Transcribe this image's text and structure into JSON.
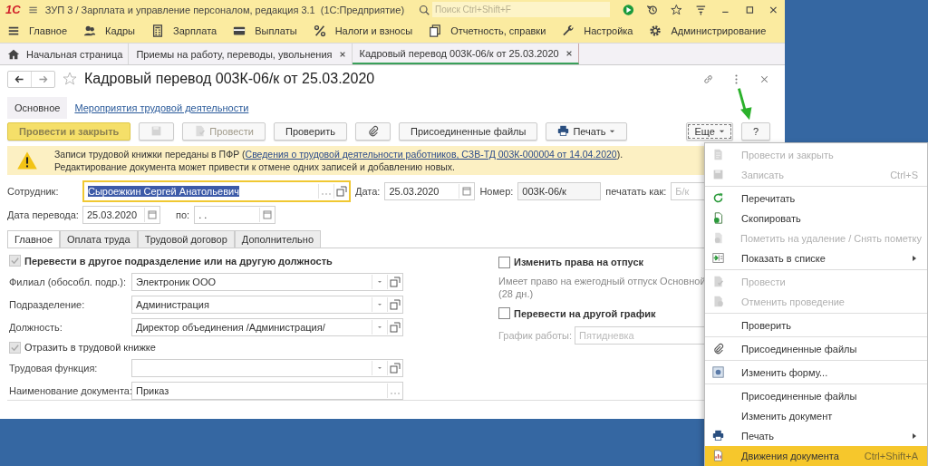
{
  "window": {
    "logo": "1С",
    "title": "ЗУП 3 / Зарплата и управление персоналом, редакция 3.1  (1С:Предприятие)",
    "search": {
      "placeholder": "Поиск Ctrl+Shift+F"
    }
  },
  "sections": [
    {
      "kind": "menu",
      "label": "Главное"
    },
    {
      "kind": "people",
      "label": "Кадры"
    },
    {
      "kind": "calc",
      "label": "Зарплата"
    },
    {
      "kind": "card",
      "label": "Выплаты"
    },
    {
      "kind": "percent",
      "label": "Налоги и взносы"
    },
    {
      "kind": "report",
      "label": "Отчетность, справки"
    },
    {
      "kind": "wrench",
      "label": "Настройка"
    },
    {
      "kind": "gear",
      "label": "Администрирование"
    }
  ],
  "open_tabs": [
    {
      "kind": "home",
      "label": "Начальная страница",
      "selected": false
    },
    {
      "kind": "closable",
      "label": "Приемы на работу, переводы, увольнения",
      "selected": false
    },
    {
      "kind": "closable",
      "label": "Кадровый перевод 003К-06/к от 25.03.2020",
      "selected": true
    }
  ],
  "form": {
    "title": "Кадровый перевод 003К-06/к от 25.03.2020",
    "nav": [
      {
        "label": "Основное",
        "selected": true
      },
      {
        "label": "Мероприятия трудовой деятельности",
        "selected": false
      }
    ],
    "toolbar": [
      {
        "kind": "primary",
        "label": "Провести и закрыть",
        "disabled": true
      },
      {
        "kind": "save",
        "disabled": true
      },
      {
        "kind": "post",
        "label": "Провести",
        "disabled": true
      },
      {
        "kind": "text",
        "label": "Проверить",
        "disabled": false
      },
      {
        "kind": "attach",
        "disabled": false
      },
      {
        "kind": "text",
        "label": "Присоединенные файлы",
        "disabled": false
      },
      {
        "kind": "print",
        "label": "Печать",
        "disabled": false
      }
    ],
    "toolbar_right": [
      {
        "kind": "more",
        "label": "Еще",
        "disabled": false
      },
      {
        "kind": "text",
        "label": "?",
        "disabled": false
      }
    ],
    "banner": {
      "text_before": "Записи трудовой книжки переданы в ПФР (",
      "link": "Сведения о трудовой деятельности работников, СЗВ-ТД 003К-000004 от 14.04.2020",
      "text_after": ").",
      "line2": "Редактирование документа может привести к отмене одних записей и добавлению новых."
    },
    "employee": {
      "label": "Сотрудник:",
      "value": "Сыроежкин Сергей Анатольевич"
    },
    "date": {
      "label": "Дата:",
      "value": "25.03.2020"
    },
    "number": {
      "label": "Номер:",
      "value": "003К-06/к"
    },
    "print_as": {
      "label": "печатать как:",
      "value": "Б/к",
      "disabled": true
    },
    "transfer_date": {
      "label": "Дата перевода:",
      "value": "25.03.2020"
    },
    "until": {
      "label": "по:",
      "value": ". ."
    },
    "tabs": [
      {
        "label": "Главное",
        "selected": true
      },
      {
        "label": "Оплата труда",
        "selected": false
      },
      {
        "label": "Трудовой договор",
        "selected": false
      },
      {
        "label": "Дополнительно",
        "selected": false
      }
    ],
    "left": [
      {
        "kind": "checkbox-heading",
        "label": "Перевести в другое подразделение или на другую должность",
        "checked": true,
        "disabled": true
      },
      {
        "kind": "select",
        "label": "Филиал (обособл. подр.):",
        "value": "Электроник ООО"
      },
      {
        "kind": "select",
        "label": "Подразделение:",
        "value": "Администрация"
      },
      {
        "kind": "select",
        "label": "Должность:",
        "value": "Директор объединения /Администрация/"
      },
      {
        "kind": "checkbox",
        "label": "Отразить в трудовой книжке",
        "checked": true,
        "disabled": true
      },
      {
        "kind": "select",
        "label": "Трудовая функция:"
      },
      {
        "kind": "choice",
        "label": "Наименование документа:",
        "value": "Приказ"
      }
    ],
    "right": [
      {
        "kind": "checkbox-heading",
        "label": "Изменить права на отпуск",
        "checked": false,
        "disabled": false
      },
      {
        "kind": "note",
        "label": "Имеет право на ежегодный отпуск Основной (28 дн.)"
      },
      {
        "kind": "checkbox-heading",
        "label": "Перевести на другой график",
        "checked": false,
        "disabled": false
      },
      {
        "kind": "input",
        "label": "График работы:",
        "value": "Пятидневка",
        "disabled": true
      }
    ]
  },
  "menu": [
    [
      {
        "kind": "doc",
        "label": "Провести и закрыть",
        "disabled": true,
        "selected": false,
        "submenu": false
      },
      {
        "kind": "save",
        "label": "Записать",
        "shortcut": "Ctrl+S",
        "disabled": true,
        "selected": false,
        "submenu": false
      }
    ],
    [
      {
        "kind": "refresh",
        "label": "Перечитать",
        "disabled": false,
        "selected": false,
        "submenu": false
      },
      {
        "kind": "copy",
        "label": "Скопировать",
        "disabled": false,
        "selected": false,
        "submenu": false
      },
      {
        "kind": "mark",
        "label": "Пометить на удаление / Снять пометку",
        "disabled": true,
        "selected": false,
        "submenu": false
      },
      {
        "kind": "list",
        "label": "Показать в списке",
        "disabled": false,
        "selected": false,
        "submenu": true
      }
    ],
    [
      {
        "kind": "post",
        "label": "Провести",
        "disabled": true,
        "selected": false,
        "submenu": false
      },
      {
        "kind": "unpost",
        "label": "Отменить проведение",
        "disabled": true,
        "selected": false,
        "submenu": false
      }
    ],
    [
      {
        "label": "Проверить",
        "disabled": false,
        "selected": false,
        "submenu": false
      }
    ],
    [
      {
        "kind": "attach",
        "label": "Присоединенные файлы",
        "disabled": false,
        "selected": false,
        "submenu": false
      }
    ],
    [
      {
        "kind": "form",
        "label": "Изменить форму...",
        "disabled": false,
        "selected": false,
        "submenu": false
      }
    ],
    [
      {
        "label": "Присоединенные файлы",
        "disabled": false,
        "selected": false,
        "submenu": false
      },
      {
        "label": "Изменить документ",
        "disabled": false,
        "selected": false,
        "submenu": false
      },
      {
        "kind": "print",
        "label": "Печать",
        "disabled": false,
        "selected": false,
        "submenu": true
      },
      {
        "kind": "chart",
        "label": "Движения документа",
        "shortcut": "Ctrl+Shift+A",
        "disabled": false,
        "selected": true,
        "submenu": false
      }
    ]
  ]
}
